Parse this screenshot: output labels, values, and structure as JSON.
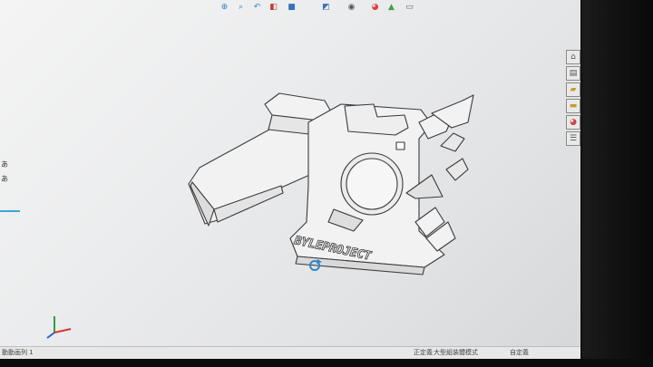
{
  "toolbar": {
    "icons": [
      "zoom-to-fit-icon",
      "zoom-area-icon",
      "previous-view-icon",
      "section-view-icon",
      "view-orientation-icon",
      "display-style-icon",
      "hide-show-icon",
      "edit-appearance-icon",
      "apply-scene-icon",
      "view-settings-icon"
    ]
  },
  "window_controls": {
    "minimize": "−",
    "restore": "□",
    "close": "✕"
  },
  "task_pane": {
    "icons": [
      "home-icon",
      "resources-icon",
      "design-library-icon",
      "file-explorer-icon",
      "appearances-icon",
      "custom-properties-icon"
    ]
  },
  "left_strip": {
    "labels": [
      "あ",
      "あ"
    ]
  },
  "model": {
    "engraving": "BYLEPROJECT"
  },
  "status_bar": {
    "tab_label": "動動画列 1",
    "custom_label": "正定義",
    "assembly_mode": "大型組装體模式",
    "custom_right": "自定義"
  },
  "colors": {
    "viewport_bg": "#ecedee",
    "model_face": "#f2f2f2",
    "model_edge": "#3b3b3b",
    "accent": "#2f86c9"
  }
}
